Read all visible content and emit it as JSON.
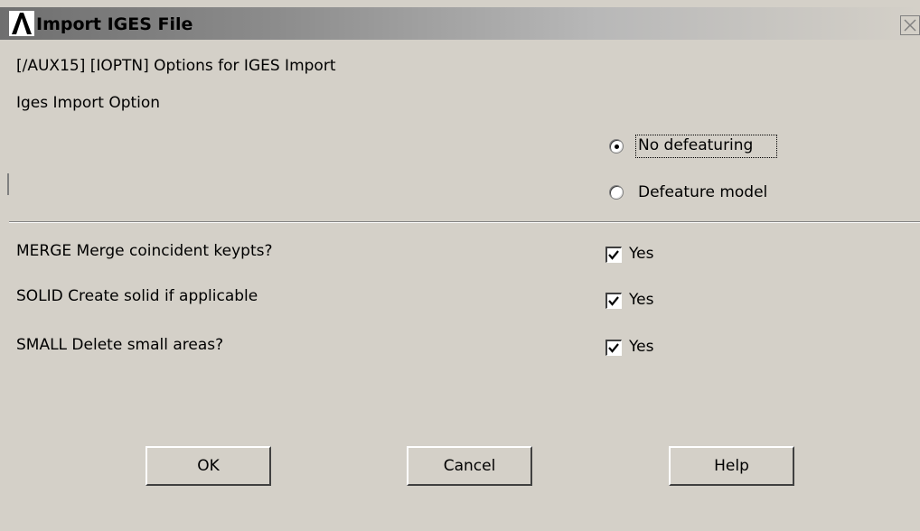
{
  "window": {
    "title": "Import IGES File",
    "icon": "ansys-logo-icon",
    "close_glyph": "✕"
  },
  "header": {
    "command": "[/AUX15] [IOPTN] Options for IGES Import",
    "section_label": "Iges Import Option"
  },
  "import_option": {
    "options": [
      {
        "label": "No defeaturing",
        "selected": true
      },
      {
        "label": "Defeature model",
        "selected": false
      }
    ]
  },
  "settings": [
    {
      "label": "MERGE Merge coincident keypts?",
      "checkbox_label": "Yes",
      "checked": true
    },
    {
      "label": "SOLID Create solid if applicable",
      "checkbox_label": "Yes",
      "checked": true
    },
    {
      "label": "SMALL Delete small areas?",
      "checkbox_label": "Yes",
      "checked": true
    }
  ],
  "buttons": {
    "ok": "OK",
    "cancel": "Cancel",
    "help": "Help"
  },
  "colors": {
    "background": "#d4d0c8",
    "title_gradient_start": "#6f6f6f",
    "text": "#000000"
  }
}
